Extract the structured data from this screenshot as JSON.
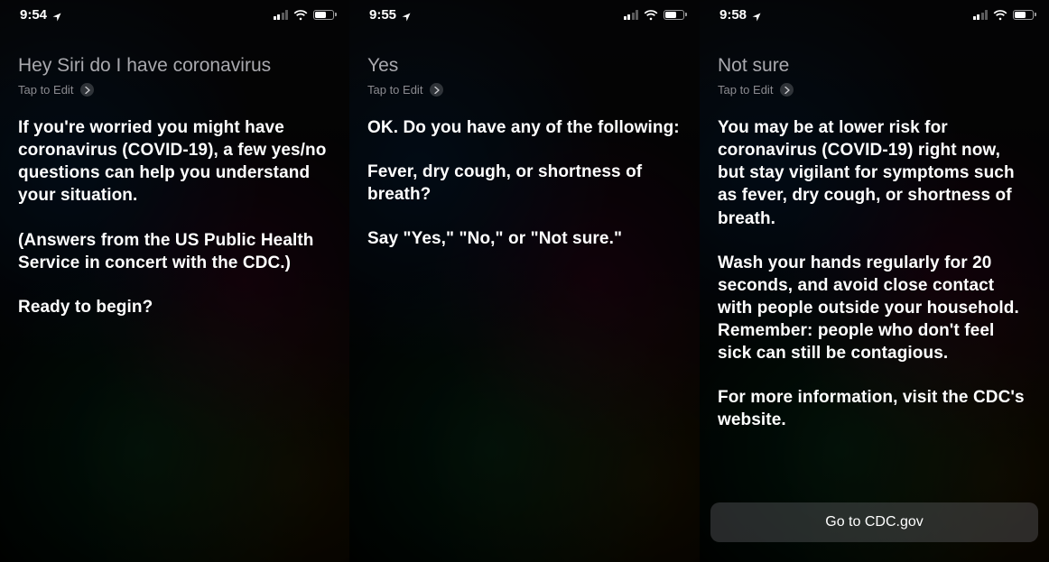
{
  "panels": [
    {
      "status": {
        "time": "9:54",
        "signal_bars": 2,
        "wifi": true,
        "battery_pct": 55
      },
      "query": "Hey Siri do I have coronavirus",
      "tap_to_edit": "Tap to Edit",
      "response": [
        "If you're worried you might have coronavirus (COVID-19), a few yes/no questions can help you understand your situation.",
        "(Answers from the US Public Health Service in concert with the CDC.)",
        "Ready to begin?"
      ]
    },
    {
      "status": {
        "time": "9:55",
        "signal_bars": 2,
        "wifi": true,
        "battery_pct": 55
      },
      "query": "Yes",
      "tap_to_edit": "Tap to Edit",
      "response": [
        "OK. Do you have any of the following:",
        "Fever, dry cough, or shortness of breath?",
        "Say \"Yes,\" \"No,\" or \"Not sure.\""
      ]
    },
    {
      "status": {
        "time": "9:58",
        "signal_bars": 2,
        "wifi": true,
        "battery_pct": 55
      },
      "query": "Not sure",
      "tap_to_edit": "Tap to Edit",
      "response": [
        "You may be at lower risk for coronavirus (COVID-19) right now, but stay vigilant for symptoms such as fever, dry cough, or shortness of breath.",
        "Wash your hands regularly for 20 seconds, and avoid close contact with people outside your household. Remember: people who don't feel sick can still be contagious.",
        "For more information, visit the CDC's website."
      ],
      "action_button": "Go to CDC.gov"
    }
  ]
}
